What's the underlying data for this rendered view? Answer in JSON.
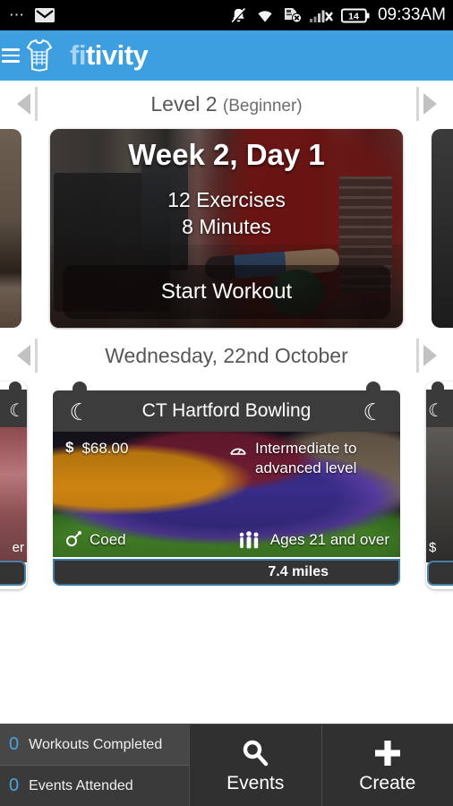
{
  "status_bar": {
    "left_icons": [
      "more-dots-icon",
      "mail-icon"
    ],
    "right_icons": [
      "silent-bell-icon",
      "wifi-icon",
      "sd-card-off-icon",
      "signal-off-icon"
    ],
    "battery_level": "14",
    "time": "09:33AM"
  },
  "app_bar": {
    "menu_icon": "hamburger-menu-icon",
    "logo_icon": "jersey-logo-icon",
    "brand_prefix": "fi",
    "brand_suffix": "tivity"
  },
  "level_nav": {
    "prev_icon": "chevron-left-icon",
    "next_icon": "chevron-right-icon",
    "title": "Level 2",
    "subtitle": "(Beginner)"
  },
  "workout_card": {
    "title": "Week 2, Day 1",
    "exercises": "12 Exercises",
    "duration": "8 Minutes",
    "cta": "Start Workout"
  },
  "date_nav": {
    "prev_icon": "chevron-left-icon",
    "next_icon": "chevron-right-icon",
    "title": "Wednesday, 22nd October"
  },
  "event_card": {
    "title": "CT Hartford Bowling",
    "hook_icon": "hanger-hook-icon",
    "price_icon": "dollar-icon",
    "price": "$68.00",
    "level_icon": "gauge-icon",
    "level": "Intermediate to advanced level",
    "gender_icon": "gender-coed-icon",
    "gender": "Coed",
    "ages_icon": "people-icon",
    "ages": "Ages 21 and over",
    "distance": "7.4 miles"
  },
  "event_peek_left": {
    "partial_text": "er"
  },
  "event_peek_right": {
    "partial_text": "$"
  },
  "bottom_bar": {
    "stats": [
      {
        "value": "0",
        "label": "Workouts Completed"
      },
      {
        "value": "0",
        "label": "Events Attended"
      }
    ],
    "buttons": [
      {
        "icon": "search-icon",
        "label": "Events"
      },
      {
        "icon": "plus-icon",
        "label": "Create"
      }
    ]
  },
  "colors": {
    "brand_blue": "#3d9ee0",
    "accent_blue": "#4aa3de",
    "card_dark": "#3c3c3c",
    "bottom_dark": "#2f2f2f"
  }
}
